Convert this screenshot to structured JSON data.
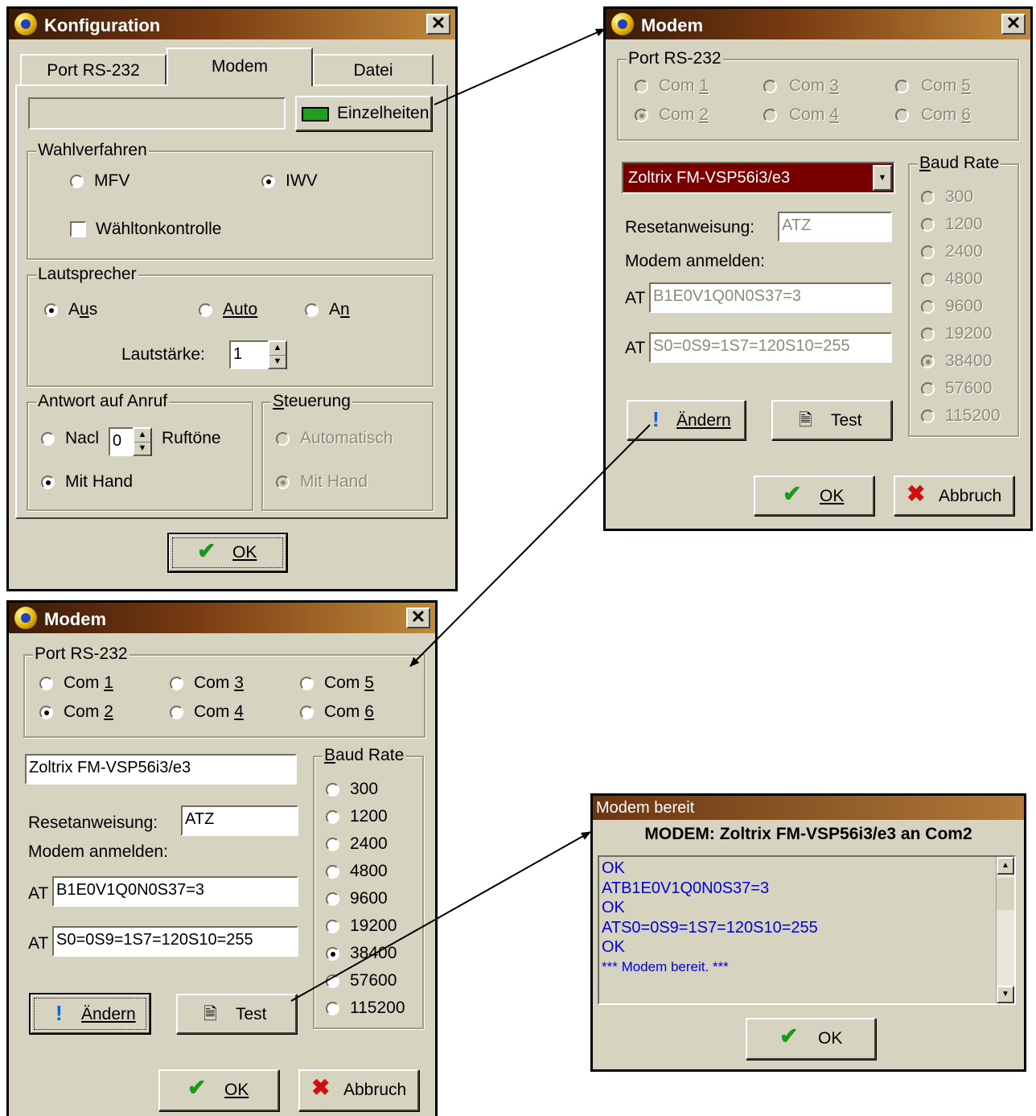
{
  "konfig": {
    "title": "Konfiguration",
    "tabs": [
      "Port RS-232",
      "Modem",
      "Datei"
    ],
    "details_label": "Einzelheiten",
    "wahl": {
      "label": "Wahlverfahren",
      "mfv": "MFV",
      "iwv": "IWV",
      "check": "Wähltonkontrolle"
    },
    "laut": {
      "label": "Lautsprecher",
      "aus": "Aus",
      "auto": "Auto",
      "an": "An",
      "vol_label": "Lautstärke:",
      "vol_value": "1"
    },
    "antwort": {
      "label": "Antwort auf Anruf",
      "nach": "Nacl",
      "count": "0",
      "ruf": "Ruftöne",
      "hand": "Mit Hand"
    },
    "steuer": {
      "label": "Steuerung",
      "auto": "Automatisch",
      "hand": "Mit Hand"
    },
    "ok": "OK"
  },
  "modem": {
    "title": "Modem",
    "port_label": "Port RS-232",
    "com_prefix": "Com ",
    "coms": [
      "1",
      "2",
      "3",
      "4",
      "5",
      "6"
    ],
    "baud_label": "Baud Rate",
    "bauds": [
      "300",
      "1200",
      "2400",
      "4800",
      "9600",
      "19200",
      "38400",
      "57600",
      "115200"
    ],
    "modem_name": "Zoltrix FM-VSP56i3/e3",
    "reset_label": "Resetanweisung:",
    "reset_value": "ATZ",
    "anmelden_label": "Modem anmelden:",
    "at": "AT",
    "init1": "B1E0V1Q0N0S37=3",
    "init2": "S0=0S9=1S7=120S10=255",
    "aendern": "Ändern",
    "test": "Test",
    "ok": "OK",
    "abbruch": "Abbruch"
  },
  "ready": {
    "title": "Modem bereit",
    "heading": "MODEM: Zoltrix FM-VSP56i3/e3 an Com2",
    "log": [
      "OK",
      "ATB1E0V1Q0N0S37=3",
      "OK",
      "ATS0=0S9=1S7=120S10=255",
      "OK",
      "*** Modem bereit. ***"
    ],
    "ok": "OK"
  },
  "colors": {
    "title_dark": "#3a1a08",
    "title_light": "#c08a3c",
    "face": "#d6d3c0",
    "log_text": "#0000e0",
    "selected_modem": "#7a0000"
  }
}
